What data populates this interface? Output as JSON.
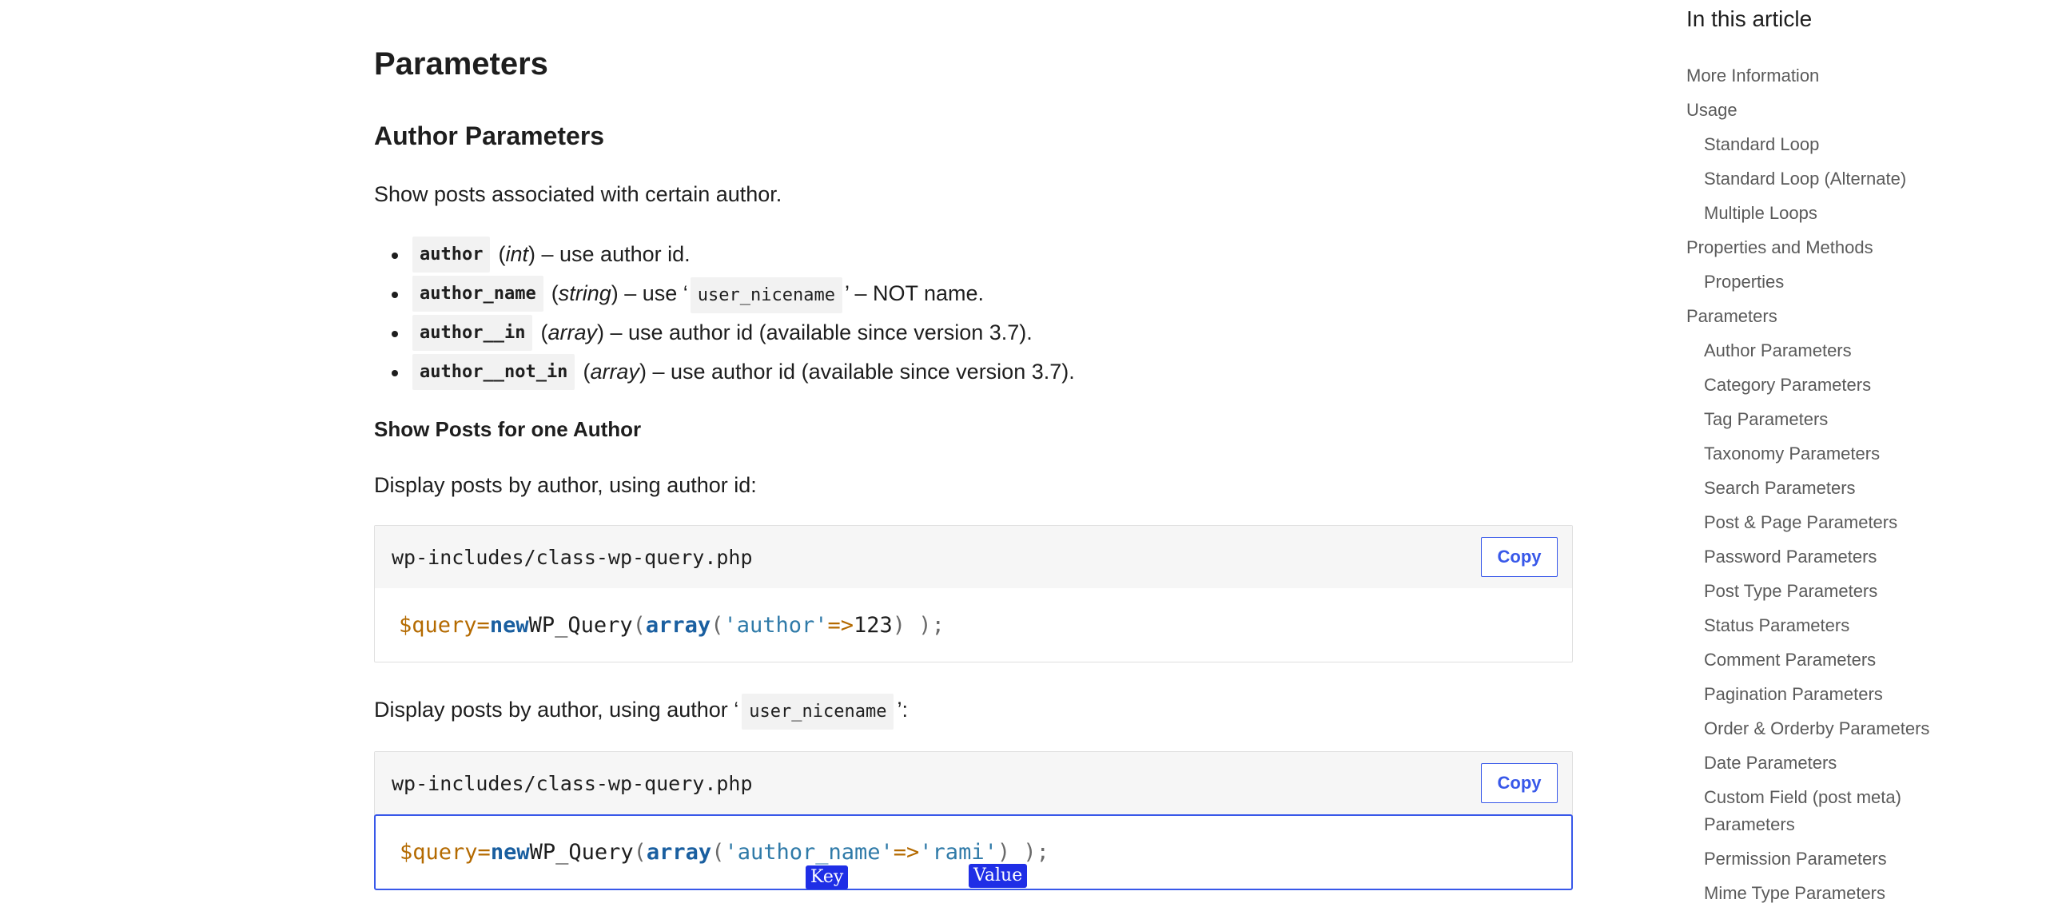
{
  "article": {
    "h2": "Parameters",
    "h3": "Author Parameters",
    "intro": "Show posts associated with certain author.",
    "params": [
      {
        "code": "author",
        "type": "int",
        "pre": "(",
        "post": ") – use author id."
      },
      {
        "code": "author_name",
        "type": "string",
        "pre": "(",
        "post": ") – use ‘",
        "code2": "user_nicename",
        "post2": "’ – NOT name."
      },
      {
        "code": "author__in",
        "type": "array",
        "pre": "(",
        "post": ") – use author id (available since version 3.7)."
      },
      {
        "code": "author__not_in",
        "type": "array",
        "pre": "(",
        "post": ") – use author id (available since version 3.7)."
      }
    ],
    "h4": "Show Posts for one Author",
    "display1": "Display posts by author, using author id:",
    "display2_pre": "Display posts by author, using author ‘",
    "display2_code": "user_nicename",
    "display2_post": "’:",
    "codeblock1": {
      "filename": "wp-includes/class-wp-query.php",
      "copy": "Copy",
      "var": "$query",
      "eq": "=",
      "new": "new",
      "cls": "WP_Query",
      "open": "(",
      "arr": "array",
      "open2": "(",
      "key": "'author'",
      "arrow": "=>",
      "val": "123",
      "close": ") );"
    },
    "codeblock2": {
      "filename": "wp-includes/class-wp-query.php",
      "copy": "Copy",
      "var": "$query",
      "eq": "=",
      "new": "new",
      "cls": "WP_Query",
      "open": "(",
      "arr": "array",
      "open2": "(",
      "key": "'author_name'",
      "arrow": "=>",
      "val": "'rami'",
      "close": ") );",
      "tag_key": "Key",
      "tag_value": "Value"
    }
  },
  "toc": {
    "title": "In this article",
    "items": [
      {
        "label": "More Information",
        "sub": false
      },
      {
        "label": "Usage",
        "sub": false
      },
      {
        "label": "Standard Loop",
        "sub": true
      },
      {
        "label": "Standard Loop (Alternate)",
        "sub": true
      },
      {
        "label": "Multiple Loops",
        "sub": true
      },
      {
        "label": "Properties and Methods",
        "sub": false
      },
      {
        "label": "Properties",
        "sub": true
      },
      {
        "label": "Parameters",
        "sub": false
      },
      {
        "label": "Author Parameters",
        "sub": true
      },
      {
        "label": "Category Parameters",
        "sub": true
      },
      {
        "label": "Tag Parameters",
        "sub": true
      },
      {
        "label": "Taxonomy Parameters",
        "sub": true
      },
      {
        "label": "Search Parameters",
        "sub": true
      },
      {
        "label": "Post & Page Parameters",
        "sub": true
      },
      {
        "label": "Password Parameters",
        "sub": true
      },
      {
        "label": "Post Type Parameters",
        "sub": true
      },
      {
        "label": "Status Parameters",
        "sub": true
      },
      {
        "label": "Comment Parameters",
        "sub": true
      },
      {
        "label": "Pagination Parameters",
        "sub": true
      },
      {
        "label": "Order & Orderby Parameters",
        "sub": true
      },
      {
        "label": "Date Parameters",
        "sub": true
      },
      {
        "label": "Custom Field (post meta) Parameters",
        "sub": true
      },
      {
        "label": "Permission Parameters",
        "sub": true
      },
      {
        "label": "Mime Type Parameters",
        "sub": true
      }
    ]
  },
  "colors": {
    "accent": "#3858e9",
    "tag_bg": "#1f2ee6",
    "code_var": "#b46a00",
    "code_kw": "#1a5fa0",
    "code_str": "#2f7aa8"
  }
}
